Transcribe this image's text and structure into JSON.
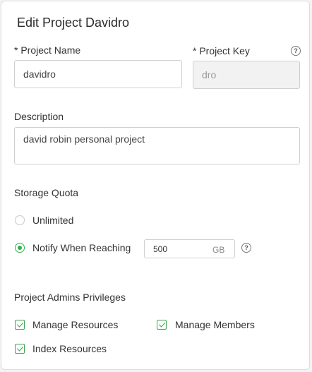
{
  "dialog": {
    "title": "Edit Project Davidro"
  },
  "fields": {
    "project_name_label": "* Project Name",
    "project_name_value": "davidro",
    "project_key_label": "* Project Key",
    "project_key_value": "dro",
    "description_label": "Description",
    "description_value": "david robin personal project"
  },
  "storage": {
    "label": "Storage Quota",
    "unlimited_label": "Unlimited",
    "notify_label": "Notify When Reaching",
    "quota_value": "500",
    "quota_unit": "GB",
    "selected": "notify"
  },
  "privileges": {
    "label": "Project Admins Privileges",
    "items": [
      {
        "label": "Manage Resources",
        "checked": true
      },
      {
        "label": "Manage Members",
        "checked": true
      },
      {
        "label": "Index Resources",
        "checked": true
      }
    ]
  },
  "colors": {
    "accent_green": "#2fb14a"
  },
  "icons": {
    "help": "question-circle-icon"
  }
}
